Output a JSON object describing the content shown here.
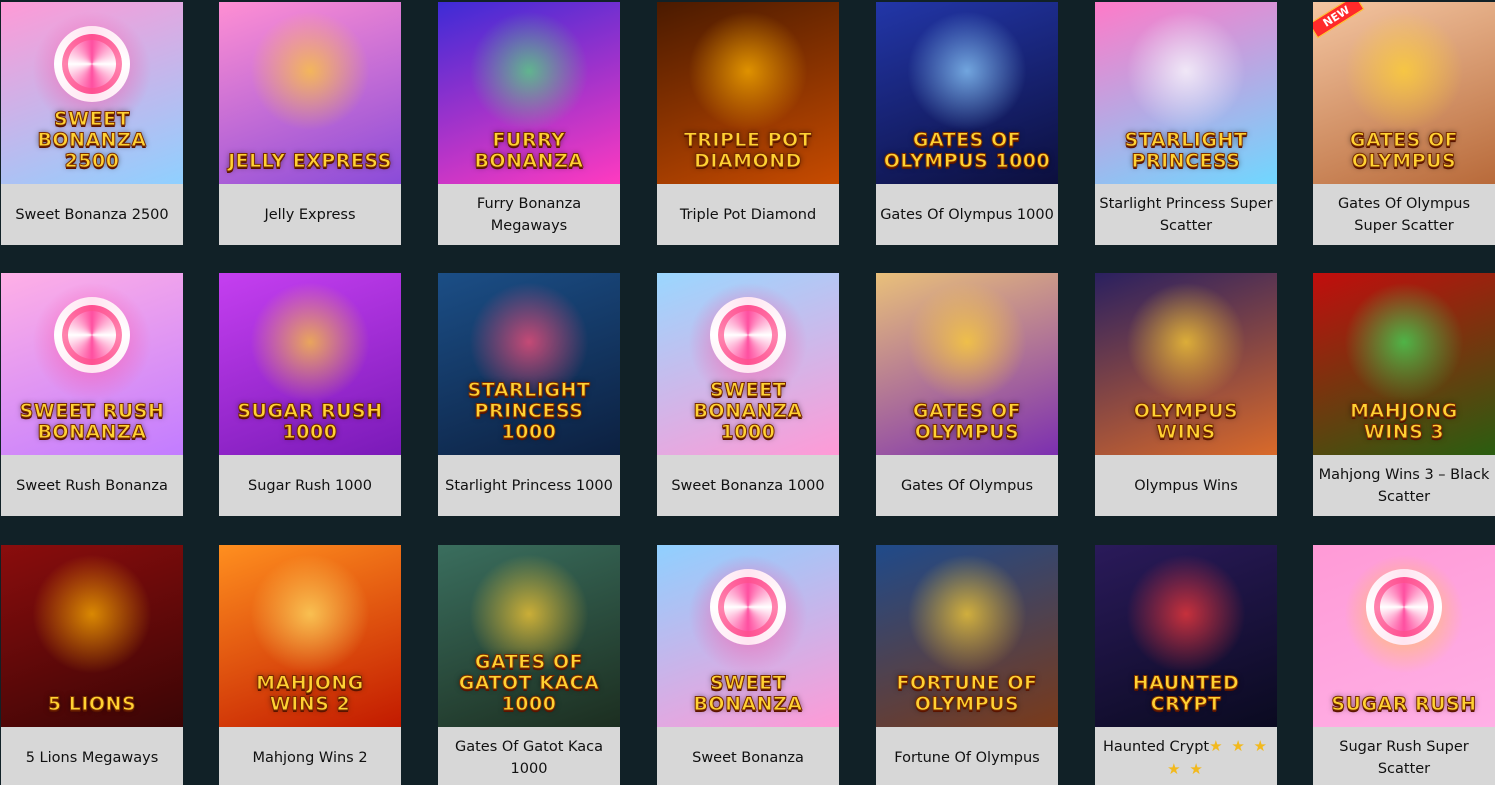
{
  "games": [
    {
      "title": "Sweet Bonanza 2500",
      "logo": "Sweet Bonanza 2500",
      "bg": [
        "#ff9ad6",
        "#8fd0ff"
      ],
      "accent": "#ff4fa0",
      "motif": "swirl"
    },
    {
      "title": "Jelly Express",
      "logo": "Jelly Express",
      "bg": [
        "#ff8fd3",
        "#8a4bd8"
      ],
      "accent": "#ffcc33",
      "motif": "glow"
    },
    {
      "title": "Furry Bonanza Megaways",
      "logo": "Furry Bonanza",
      "bg": [
        "#3d2bd6",
        "#ff3ac0"
      ],
      "accent": "#52e07a",
      "motif": "glow"
    },
    {
      "title": "Triple Pot Diamond",
      "logo": "Triple Pot Diamond",
      "bg": [
        "#4a1a00",
        "#c74b00"
      ],
      "accent": "#ffb300",
      "motif": "glow"
    },
    {
      "title": "Gates Of Olympus 1000",
      "logo": "Gates of Olympus 1000",
      "bg": [
        "#2236a8",
        "#0c0f3d"
      ],
      "accent": "#8fd0ff",
      "motif": "glow"
    },
    {
      "title": "Starlight Princess Super Scatter",
      "logo": "Starlight Princess",
      "bg": [
        "#ff7ac8",
        "#6fd7ff"
      ],
      "accent": "#ffffff",
      "motif": "glow"
    },
    {
      "title": "Gates Of Olympus Super Scatter",
      "logo": "Gates of Olympus",
      "bg": [
        "#f4c6a2",
        "#b86a3a"
      ],
      "accent": "#ffd233",
      "motif": "glow",
      "badge": "NEW"
    },
    {
      "title": "Sweet Rush Bonanza",
      "logo": "Sweet Rush Bonanza",
      "bg": [
        "#ffb0e6",
        "#c27cff"
      ],
      "accent": "#ff4fa0",
      "motif": "swirl"
    },
    {
      "title": "Sugar Rush 1000",
      "logo": "Sugar Rush 1000",
      "bg": [
        "#c53ff0",
        "#7a1ab8"
      ],
      "accent": "#ffcc33",
      "motif": "glow"
    },
    {
      "title": "Starlight Princess 1000",
      "logo": "Starlight Princess 1000",
      "bg": [
        "#1b4e86",
        "#0c2040"
      ],
      "accent": "#ff4f7a",
      "motif": "glow"
    },
    {
      "title": "Sweet Bonanza 1000",
      "logo": "Sweet Bonanza 1000",
      "bg": [
        "#9ad7ff",
        "#ff9ad6"
      ],
      "accent": "#ff4fa0",
      "motif": "swirl"
    },
    {
      "title": "Gates Of Olympus",
      "logo": "Gates of Olympus",
      "bg": [
        "#e9c07a",
        "#7c2fb0"
      ],
      "accent": "#ffd233",
      "motif": "glow"
    },
    {
      "title": "Olympus Wins",
      "logo": "Olympus Wins",
      "bg": [
        "#2a2060",
        "#d96a2a"
      ],
      "accent": "#ffd233",
      "motif": "glow"
    },
    {
      "title": "Mahjong Wins 3 – Black Scatter",
      "logo": "Mahjong Wins 3",
      "bg": [
        "#c20d0d",
        "#2a5e10"
      ],
      "accent": "#3ee05a",
      "motif": "glow"
    },
    {
      "title": "5 Lions Megaways",
      "logo": "5 Lions",
      "bg": [
        "#8a0d0d",
        "#3a0505"
      ],
      "accent": "#ffb300",
      "motif": "glow"
    },
    {
      "title": "Mahjong Wins 2",
      "logo": "Mahjong Wins 2",
      "bg": [
        "#ff8f1f",
        "#c21a00"
      ],
      "accent": "#ffe066",
      "motif": "glow"
    },
    {
      "title": "Gates Of Gatot Kaca 1000",
      "logo": "Gates of Gatot Kaca 1000",
      "bg": [
        "#3a6e5e",
        "#1c2e20"
      ],
      "accent": "#ffcc33",
      "motif": "glow"
    },
    {
      "title": "Sweet Bonanza",
      "logo": "Sweet Bonanza",
      "bg": [
        "#8fd0ff",
        "#ff9ad6"
      ],
      "accent": "#ff4fa0",
      "motif": "swirl"
    },
    {
      "title": "Fortune Of Olympus",
      "logo": "Fortune of Olympus",
      "bg": [
        "#1f4a8a",
        "#7a3a1a"
      ],
      "accent": "#ffd233",
      "motif": "glow"
    },
    {
      "title": "Haunted Crypt",
      "logo": "Haunted Crypt",
      "bg": [
        "#2a1a5a",
        "#0a0a20"
      ],
      "accent": "#ff3a3a",
      "motif": "glow",
      "rating": "★ ★ ★ ★ ★"
    },
    {
      "title": "Sugar Rush Super Scatter",
      "logo": "Sugar Rush",
      "bg": [
        "#ff9ad6",
        "#ffb0e6"
      ],
      "accent": "#ffcc33",
      "motif": "swirl"
    }
  ]
}
